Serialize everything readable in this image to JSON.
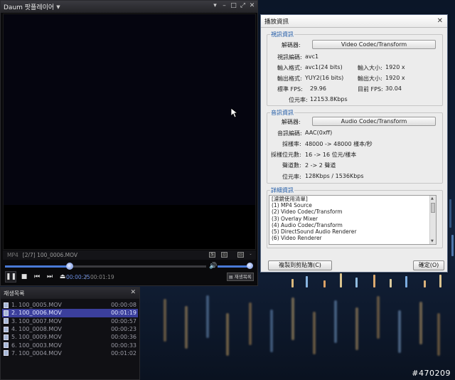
{
  "player": {
    "title": "Daum 팟플레이어",
    "format": "MP4",
    "playing_info": "[2/7] 100_0006.MOV",
    "time_current": "00:00:25",
    "time_separator": "/",
    "time_total": "00:01:19",
    "playlist_toggle_label": "재생목록",
    "progress_fraction": 0.32,
    "volume_fraction": 1.0
  },
  "playlist": {
    "header": "재생목록",
    "items": [
      {
        "label": "1. 100_0005.MOV",
        "duration": "00:00:08",
        "selected": false
      },
      {
        "label": "2. 100_0006.MOV",
        "duration": "00:01:19",
        "selected": true
      },
      {
        "label": "3. 100_0007.MOV",
        "duration": "00:00:57",
        "selected": false
      },
      {
        "label": "4. 100_0008.MOV",
        "duration": "00:00:23",
        "selected": false
      },
      {
        "label": "5. 100_0009.MOV",
        "duration": "00:00:36",
        "selected": false
      },
      {
        "label": "6. 100_0003.MOV",
        "duration": "00:00:33",
        "selected": false
      },
      {
        "label": "7. 100_0004.MOV",
        "duration": "00:01:02",
        "selected": false
      }
    ]
  },
  "dialog": {
    "title": "播放資訊",
    "video": {
      "group_label": "視訊資訊",
      "decoder_label": "解碼器:",
      "decoder_button": "Video Codec/Transform",
      "codec_label": "視訊編碼:",
      "codec_value": "avc1",
      "input_format_label": "輸入格式:",
      "input_format_value": "avc1(24 bits)",
      "input_size_label": "輸入大小:",
      "input_size_value": "1920 x",
      "output_format_label": "輸出格式:",
      "output_format_value": "YUY2(16 bits)",
      "output_size_label": "輸出大小:",
      "output_size_value": "1920 x",
      "target_fps_label": "標準 FPS:",
      "target_fps_value": "29.96",
      "current_fps_label": "目前 FPS:",
      "current_fps_value": "30.04",
      "bitrate_label": "位元率:",
      "bitrate_value": "12153.8Kbps"
    },
    "audio": {
      "group_label": "音訊資訊",
      "decoder_label": "解碼器:",
      "decoder_button": "Audio Codec/Transform",
      "codec_label": "音訊編碼:",
      "codec_value": "AAC(0xff)",
      "sample_rate_label": "採樣率:",
      "sample_rate_value": "48000 -> 48000 樣本/秒",
      "bits_label": "採樣位元數:",
      "bits_value": "16 -> 16 位元/樣本",
      "channels_label": "聲道數:",
      "channels_value": "2 -> 2 聲道",
      "bitrate_label": "位元率:",
      "bitrate_value": "128Kbps / 1536Kbps"
    },
    "details": {
      "group_label": "詳細資訊",
      "items": [
        "[濾鏡使用清單]",
        "(1) MP4 Source",
        "(2) Video Codec/Transform",
        "(3) Overlay Mixer",
        "(4) Audio Codec/Transform",
        "(5) DirectSound Audio Renderer",
        "(6) Video Renderer"
      ]
    },
    "copy_button": "複製到剪貼簿(C)",
    "ok_button": "確定(O)"
  },
  "watermark": "#470209",
  "colors": {
    "accent": "#4a7ad6",
    "playlist_selected": "#3b3f9c",
    "group_label": "#1f5aa6"
  }
}
